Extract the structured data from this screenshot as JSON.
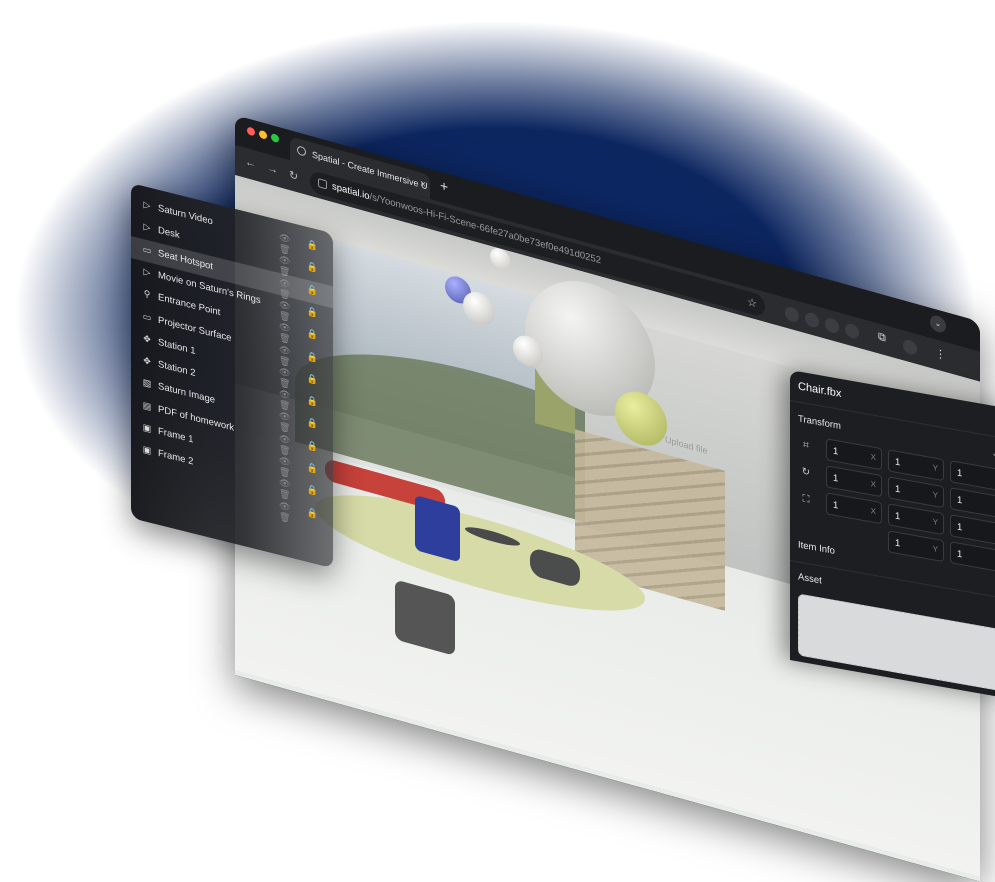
{
  "browser": {
    "tab_title": "Spatial - Create Immersive U",
    "tab_close": "×",
    "new_tab": "+",
    "url_host": "spatial.io",
    "url_path": "/s/Yoonwoos-Hi-Fi-Scene-66fe27a0be73ef0e491d0252",
    "nav": {
      "back": "←",
      "forward": "→",
      "reload": "↻"
    },
    "star": "☆",
    "menu": "⋮",
    "extensions": "⧉",
    "dropdown": "⌄",
    "traffic_light_colors": [
      "#ff5f57",
      "#febc2e",
      "#28c840"
    ]
  },
  "scene": {
    "upload_label": "Upload file"
  },
  "layers": {
    "items": [
      {
        "label": "Saturn Video",
        "icon": "video-icon",
        "glyph": "▷",
        "selected": false
      },
      {
        "label": "Desk",
        "icon": "video-icon",
        "glyph": "▷",
        "selected": false
      },
      {
        "label": "Seat Hotspot",
        "icon": "seat-icon",
        "glyph": "▭",
        "selected": true
      },
      {
        "label": "Movie on Saturn's Rings",
        "icon": "video-icon",
        "glyph": "▷",
        "selected": false
      },
      {
        "label": "Entrance Point",
        "icon": "pin-icon",
        "glyph": "⚲",
        "selected": false
      },
      {
        "label": "Projector Surface",
        "icon": "screen-icon",
        "glyph": "▭",
        "selected": false
      },
      {
        "label": "Station 1",
        "icon": "move-icon",
        "glyph": "✥",
        "selected": false
      },
      {
        "label": "Station 2",
        "icon": "move-icon",
        "glyph": "✥",
        "selected": false
      },
      {
        "label": "Saturn Image",
        "icon": "image-icon",
        "glyph": "▨",
        "selected": false
      },
      {
        "label": "PDF of homework",
        "icon": "document-icon",
        "glyph": "▤",
        "selected": false
      },
      {
        "label": "Frame 1",
        "icon": "frame-icon",
        "glyph": "▣",
        "selected": false
      },
      {
        "label": "Frame 2",
        "icon": "frame-icon",
        "glyph": "▣",
        "selected": false
      },
      {
        "label": "",
        "icon": "",
        "glyph": "",
        "selected": false
      }
    ],
    "action_icons": "👁 🔒 🗑"
  },
  "props": {
    "title": "Chair.fbx",
    "transform_title": "Transform",
    "transform_chevron": "⌄",
    "item_info_title": "Item Info",
    "asset_title": "Asset",
    "rows": [
      {
        "icon": "crop-icon",
        "glyph": "⌗",
        "values": [
          "1",
          "1",
          "1"
        ],
        "axes": [
          "X",
          "Y",
          ""
        ]
      },
      {
        "icon": "rotate-icon",
        "glyph": "↻",
        "values": [
          "1",
          "1",
          "1"
        ],
        "axes": [
          "X",
          "Y",
          ""
        ]
      },
      {
        "icon": "scale-icon",
        "glyph": "⛶",
        "values": [
          "1",
          "1",
          "1"
        ],
        "axes": [
          "X",
          "Y",
          ""
        ]
      },
      {
        "icon": "",
        "glyph": "",
        "values": [
          "",
          "1",
          "1"
        ],
        "axes": [
          "",
          "Y",
          ""
        ]
      }
    ]
  }
}
